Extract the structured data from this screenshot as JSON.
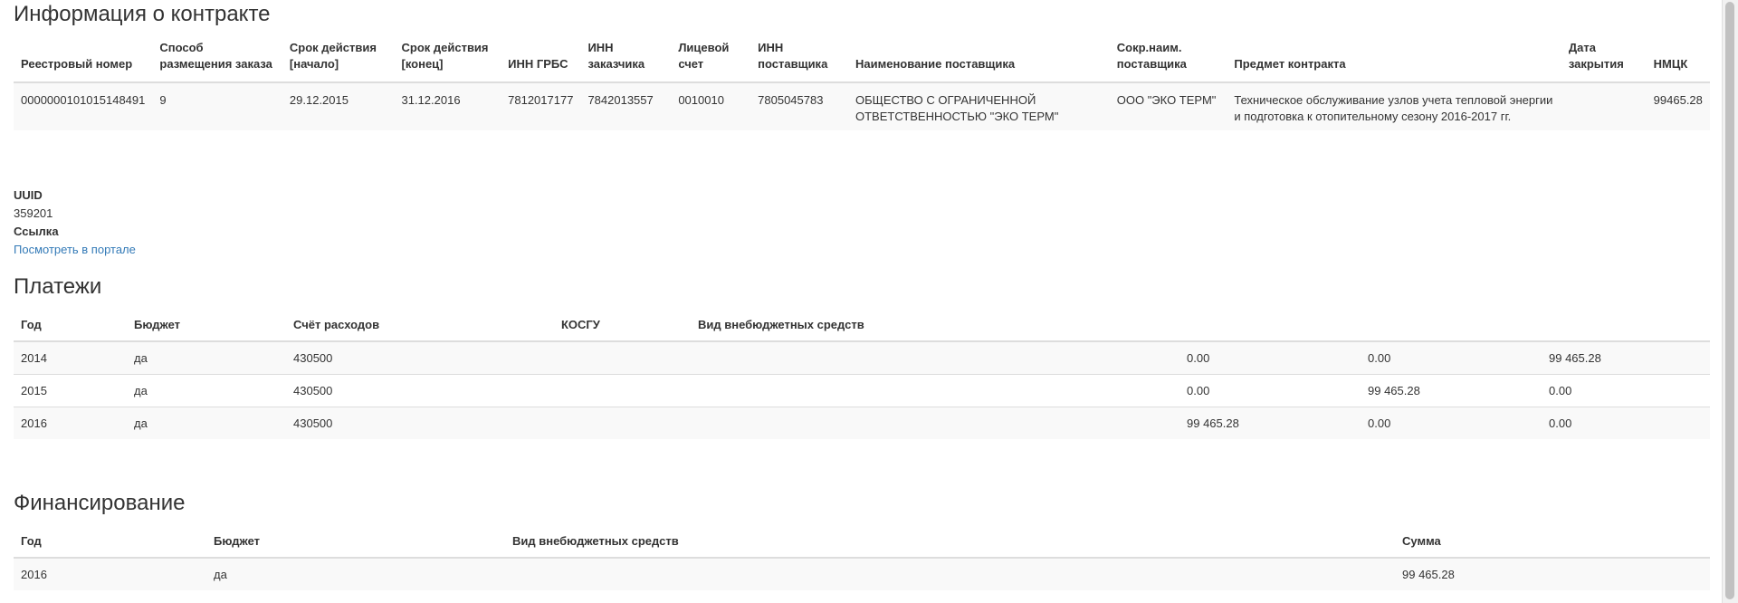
{
  "contract": {
    "title": "Информация о контракте",
    "headers": [
      "Реестровый номер",
      "Способ размещения заказа",
      "Срок действия [начало]",
      "Срок действия [конец]",
      "ИНН ГРБС",
      "ИНН заказчика",
      "Лицевой счет",
      "ИНН поставщика",
      "Наименование поставщика",
      "Сокр.наим. поставщика",
      "Предмет контракта",
      "Дата закрытия",
      "НМЦК"
    ],
    "row": [
      "0000000101015148491",
      "9",
      "29.12.2015",
      "31.12.2016",
      "7812017177",
      "7842013557",
      "0010010",
      "7805045783",
      "ОБЩЕСТВО С ОГРАНИЧЕННОЙ ОТВЕТСТВЕННОСТЬЮ \"ЭКО ТЕРМ\"",
      "ООО \"ЭКО ТЕРМ\"",
      "Техническое обслуживание узлов учета тепловой энергии и подготовка к отопительному сезону 2016-2017 гг.",
      "",
      "99465.28"
    ]
  },
  "meta": {
    "uuid_label": "UUID",
    "uuid_value": "359201",
    "link_label": "Ссылка",
    "link_text": "Посмотреть в портале"
  },
  "payments": {
    "title": "Платежи",
    "headers": [
      "Год",
      "Бюджет",
      "Счёт расходов",
      "КОСГУ",
      "Вид внебюджетных средств",
      "",
      "",
      ""
    ],
    "rows": [
      [
        "2014",
        "да",
        "430500",
        "",
        "",
        "0.00",
        "0.00",
        "99 465.28"
      ],
      [
        "2015",
        "да",
        "430500",
        "",
        "",
        "0.00",
        "99 465.28",
        "0.00"
      ],
      [
        "2016",
        "да",
        "430500",
        "",
        "",
        "99 465.28",
        "0.00",
        "0.00"
      ]
    ]
  },
  "financing": {
    "title": "Финансирование",
    "headers": [
      "Год",
      "Бюджет",
      "Вид внебюджетных средств",
      "Сумма"
    ],
    "rows": [
      [
        "2016",
        "да",
        "",
        "99 465.28"
      ]
    ]
  }
}
